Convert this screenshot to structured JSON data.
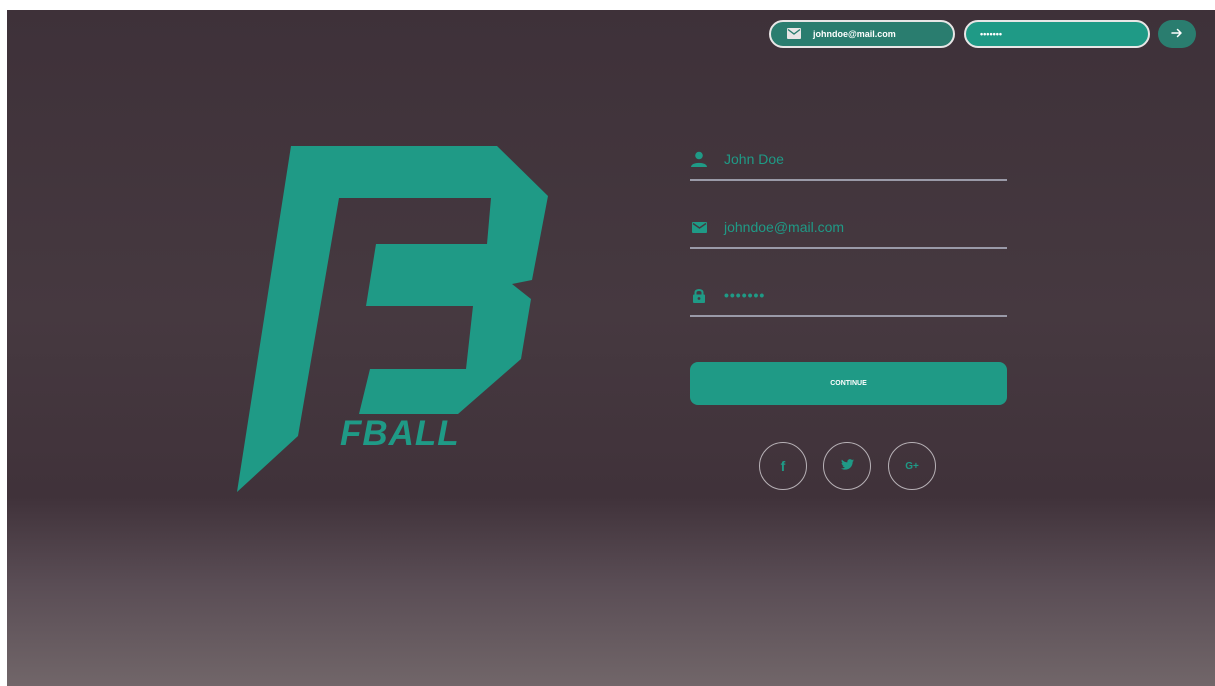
{
  "colors": {
    "accent": "#1f9a86",
    "accent_dark": "#2a7d6f",
    "background_top": "#3e3139",
    "background_bottom": "#716669",
    "underline": "#9a9aa8"
  },
  "topbar": {
    "email_value": "johndoe@mail.com",
    "email_icon": "mail-icon",
    "password_value": "•••••••",
    "go_icon": "arrow-right-icon"
  },
  "logo": {
    "wordmark": "FBALL"
  },
  "form": {
    "name": {
      "icon": "user-icon",
      "value": "John Doe"
    },
    "email": {
      "icon": "mail-icon",
      "value": "johndoe@mail.com"
    },
    "password": {
      "icon": "lock-icon",
      "value": "•••••••"
    },
    "continue_label": "CONTINUE"
  },
  "social": {
    "facebook": {
      "icon": "facebook-icon",
      "label": "f"
    },
    "twitter": {
      "icon": "twitter-icon"
    },
    "google_plus": {
      "icon": "google-plus-icon",
      "label": "G+"
    }
  }
}
